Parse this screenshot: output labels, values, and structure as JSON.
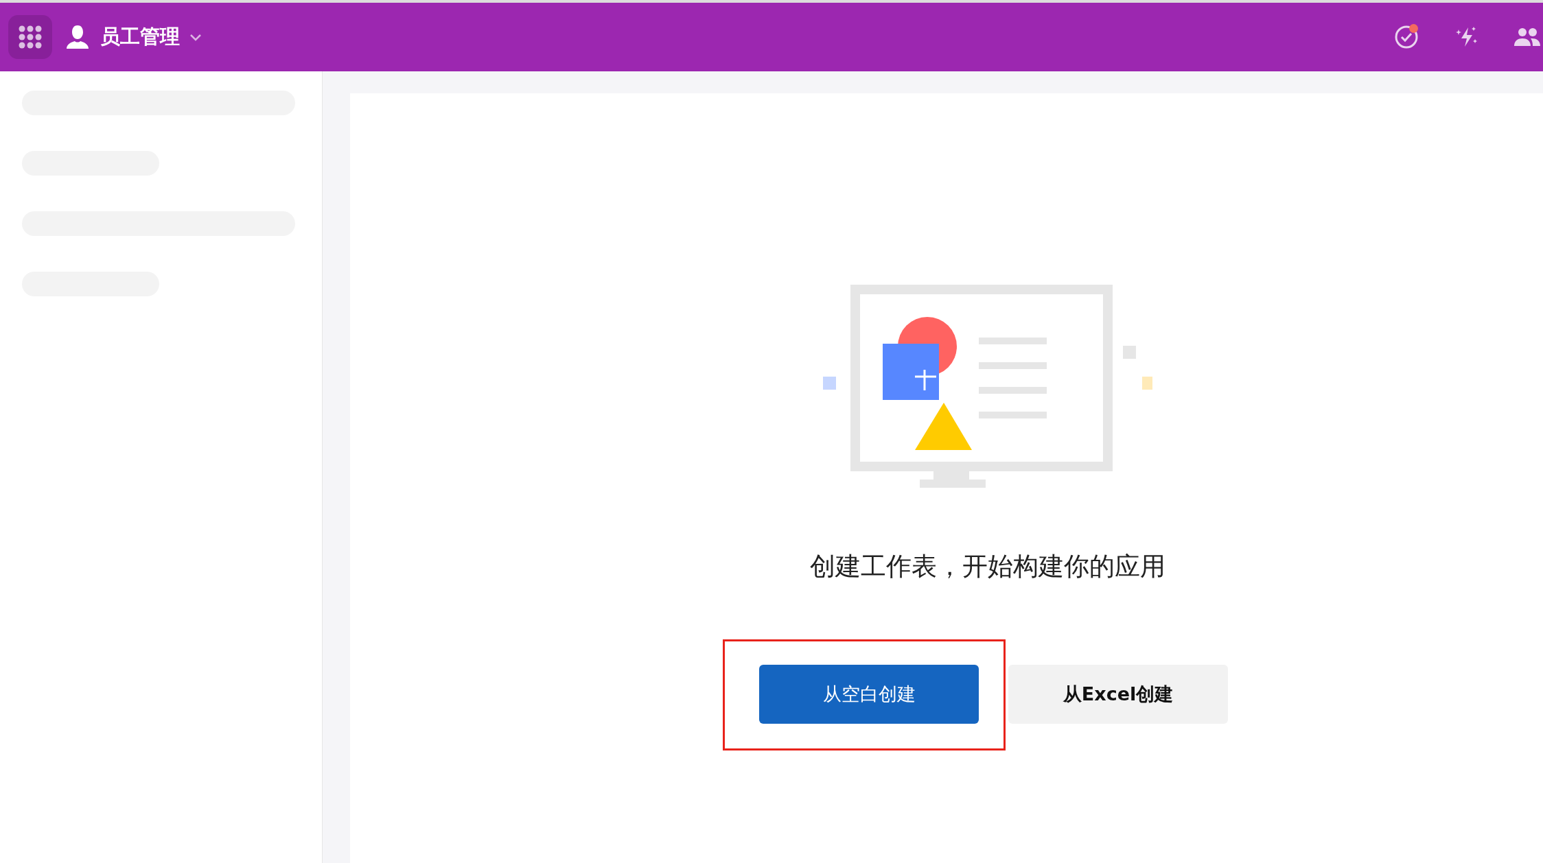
{
  "topbar": {
    "app_title": "员工管理",
    "notification_dot": true
  },
  "empty_state": {
    "heading": "创建工作表，开始构建你的应用",
    "buttons": [
      {
        "label": "从空白创建",
        "kind": "primary",
        "highlighted": true
      },
      {
        "label": "从Excel创建",
        "kind": "secondary",
        "highlighted": false
      }
    ]
  }
}
